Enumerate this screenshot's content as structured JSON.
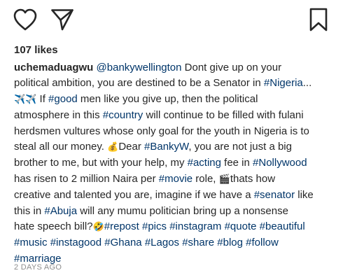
{
  "actions": {
    "like_icon": "heart-outline",
    "share_icon": "paper-plane",
    "save_icon": "bookmark-outline"
  },
  "likes": "107 likes",
  "caption": {
    "username": "uchemaduagwu",
    "lines": [
      [
        {
          "t": "username",
          "v": "uchemaduagwu"
        },
        {
          "t": "text",
          "v": " "
        },
        {
          "t": "link",
          "v": "@bankywellington"
        },
        {
          "t": "text",
          "v": "  Dont give up on your"
        }
      ],
      [
        {
          "t": "text",
          "v": "political ambition, you are destined to be a Senator in "
        },
        {
          "t": "link",
          "v": "#Nigeria"
        },
        {
          "t": "text",
          "v": "..."
        }
      ],
      [
        {
          "t": "emoji",
          "v": "✈️✈️"
        },
        {
          "t": "text",
          "v": " If "
        },
        {
          "t": "link",
          "v": "#good"
        },
        {
          "t": "text",
          "v": " men like you give up, then the political"
        }
      ],
      [
        {
          "t": "text",
          "v": "atmosphere in this "
        },
        {
          "t": "link",
          "v": "#country"
        },
        {
          "t": "text",
          "v": " will continue to be filled with fulani"
        }
      ],
      [
        {
          "t": "text",
          "v": "herdsmen vultures whose only goal for the youth in Nigeria is to"
        }
      ],
      [
        {
          "t": "text",
          "v": "steal all our money. "
        },
        {
          "t": "emoji",
          "v": "💰"
        },
        {
          "t": "text",
          "v": "Dear "
        },
        {
          "t": "link",
          "v": "#BankyW"
        },
        {
          "t": "text",
          "v": ", you are not just a big"
        }
      ],
      [
        {
          "t": "text",
          "v": "brother to me, but with your help, my "
        },
        {
          "t": "link",
          "v": "#acting"
        },
        {
          "t": "text",
          "v": " fee in "
        },
        {
          "t": "link",
          "v": "#Nollywood"
        }
      ],
      [
        {
          "t": "text",
          "v": "has risen to 2 million Naira per "
        },
        {
          "t": "link",
          "v": "#movie"
        },
        {
          "t": "text",
          "v": " role, "
        },
        {
          "t": "emoji",
          "v": "🎬"
        },
        {
          "t": "text",
          "v": "thats how"
        }
      ],
      [
        {
          "t": "text",
          "v": "creative and talented you are, imagine if we have a "
        },
        {
          "t": "link",
          "v": "#senator"
        },
        {
          "t": "text",
          "v": " like"
        }
      ],
      [
        {
          "t": "text",
          "v": "this in "
        },
        {
          "t": "link",
          "v": "#Abuja"
        },
        {
          "t": "text",
          "v": " will any mumu politician bring up a nonsense"
        }
      ],
      [
        {
          "t": "text",
          "v": "hate speech bill?"
        },
        {
          "t": "emoji",
          "v": "🤣"
        },
        {
          "t": "link",
          "v": "#repost"
        },
        {
          "t": "text",
          "v": " "
        },
        {
          "t": "link",
          "v": "#pics"
        },
        {
          "t": "text",
          "v": " "
        },
        {
          "t": "link",
          "v": "#instagram"
        },
        {
          "t": "text",
          "v": " "
        },
        {
          "t": "link",
          "v": "#quote"
        },
        {
          "t": "text",
          "v": " "
        },
        {
          "t": "link",
          "v": "#beautiful"
        }
      ],
      [
        {
          "t": "link",
          "v": "#music"
        },
        {
          "t": "text",
          "v": " "
        },
        {
          "t": "link",
          "v": "#instagood"
        },
        {
          "t": "text",
          "v": " "
        },
        {
          "t": "link",
          "v": "#Ghana"
        },
        {
          "t": "text",
          "v": " "
        },
        {
          "t": "link",
          "v": "#Lagos"
        },
        {
          "t": "text",
          "v": " "
        },
        {
          "t": "link",
          "v": "#share"
        },
        {
          "t": "text",
          "v": " "
        },
        {
          "t": "link",
          "v": "#blog"
        },
        {
          "t": "text",
          "v": " "
        },
        {
          "t": "link",
          "v": "#follow"
        }
      ],
      [
        {
          "t": "link",
          "v": "#marriage"
        }
      ]
    ]
  },
  "timestamp": "2 DAYS AGO",
  "colors": {
    "text": "#262626",
    "link": "#003569",
    "muted": "#8e8e8e",
    "background": "#ffffff"
  }
}
